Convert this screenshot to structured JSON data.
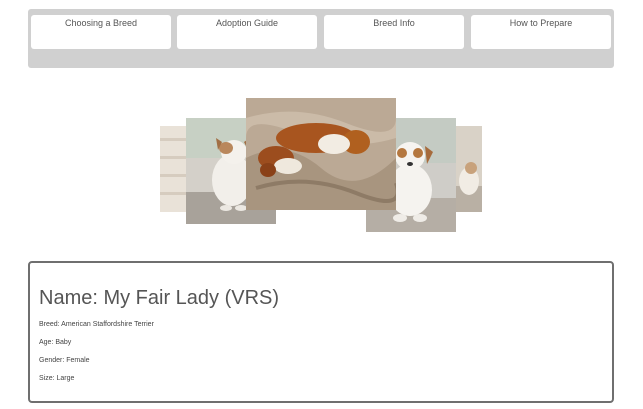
{
  "nav": {
    "tabs": [
      {
        "label": "Choosing a Breed"
      },
      {
        "label": "Adoption Guide"
      },
      {
        "label": "Breed Info"
      },
      {
        "label": "How to Prepare"
      }
    ]
  },
  "carousel": {
    "slides": [
      {
        "subject": "puppies sleeping on blanket",
        "position": "center"
      },
      {
        "subject": "puppy sitting",
        "position": "left"
      },
      {
        "subject": "puppy lying down",
        "position": "right"
      },
      {
        "subject": "fence background",
        "position": "far-left"
      },
      {
        "subject": "puppy on path",
        "position": "far-right"
      }
    ]
  },
  "pet": {
    "name_heading": "Name:  My Fair Lady (VRS)",
    "breed": "Breed: American Staffordshire Terrier",
    "age": "Age: Baby",
    "gender": "Gender: Female",
    "size": "Size: Large"
  },
  "colors": {
    "nav_background": "#d0d0d0",
    "card_border": "#6f6f6f",
    "heading_text": "#555555"
  }
}
